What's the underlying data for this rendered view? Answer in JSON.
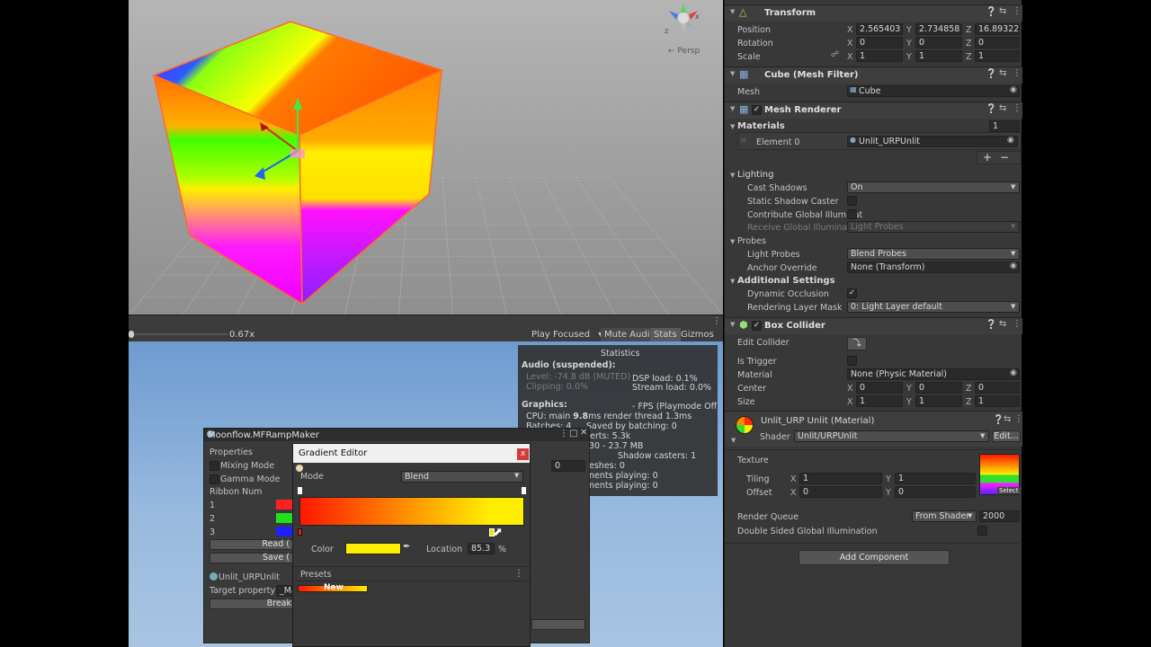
{
  "scene": {
    "persp_label": "Persp",
    "axis_z": "z",
    "axis_x": "x"
  },
  "game_toolbar": {
    "scale_value": "0.67x",
    "play_focused": "Play Focused",
    "mute_audio": "Mute Audio",
    "stats": "Stats",
    "gizmos": "Gizmos"
  },
  "stats": {
    "title": "Statistics",
    "audio_header": "Audio (suspended):",
    "level": "Level: -74.8 dB (MUTED)",
    "clipping": "Clipping: 0.0%",
    "dsp_load": "DSP load: 0.1%",
    "stream_load": "Stream load: 0.0%",
    "graphics_header": "Graphics:",
    "fps": "- FPS (Playmode Off",
    "cpu_prefix": "CPU: main ",
    "cpu_main": "9.8",
    "cpu_suffix": "ms  render thread 1.3ms",
    "batches": "Batches: 4",
    "saved_batching": "Saved by batching: 0",
    "verts": "erts: 5.3k",
    "memory": "30 - 23.7 MB",
    "shadow_casters": "Shadow casters: 1",
    "meshes": "eshes: 0",
    "animations_playing": "nents playing: 0",
    "animators_playing": "nents playing: 0"
  },
  "ramp_window": {
    "title": "Moonflow.MFRampMaker",
    "properties": "Properties",
    "mixing_mode": "Mixing Mode",
    "gamma_mode": "Gamma Mode",
    "ribbon_num": "Ribbon Num",
    "ribbon_value": "0",
    "rows": [
      {
        "label": "1",
        "color": "#ff2020"
      },
      {
        "label": "2",
        "color": "#20e020"
      },
      {
        "label": "3",
        "color": "#2020ff"
      }
    ],
    "read_button": "Read (",
    "save_button": "Save (",
    "material_name": "Unlit_URPUnlit",
    "target_property": "Target property",
    "target_value": "_Ma",
    "break_button": "Break"
  },
  "gradient_editor": {
    "title": "Gradient Editor",
    "close": "x",
    "mode_label": "Mode",
    "mode_value": "Blend",
    "color_label": "Color",
    "color_value": "#ffee00",
    "location_label": "Location",
    "location_value": "85.3",
    "location_unit": "%",
    "presets_label": "Presets",
    "preset_new": "New",
    "gradient_start": "#ff1800",
    "gradient_end": "#ffee00"
  },
  "inspector": {
    "transform": {
      "title": "Transform",
      "position_label": "Position",
      "rotation_label": "Rotation",
      "scale_label": "Scale",
      "position": {
        "x": "2.565403",
        "y": "2.734858",
        "z": "16.89322"
      },
      "rotation": {
        "x": "0",
        "y": "0",
        "z": "0"
      },
      "scale": {
        "x": "1",
        "y": "1",
        "z": "1"
      }
    },
    "mesh_filter": {
      "title": "Cube (Mesh Filter)",
      "mesh_label": "Mesh",
      "mesh_value": "Cube"
    },
    "mesh_renderer": {
      "title": "Mesh Renderer",
      "materials_label": "Materials",
      "materials_count": "1",
      "element0_label": "Element 0",
      "element0_value": "Unlit_URPUnlit",
      "lighting_label": "Lighting",
      "cast_shadows_label": "Cast Shadows",
      "cast_shadows_value": "On",
      "static_shadow_caster": "Static Shadow Caster",
      "contribute_gi": "Contribute Global Illuminat",
      "receive_gi": "Receive Global Illuminatio",
      "receive_gi_value": "Light Probes",
      "probes_label": "Probes",
      "light_probes_label": "Light Probes",
      "light_probes_value": "Blend Probes",
      "anchor_override_label": "Anchor Override",
      "anchor_override_value": "None (Transform)",
      "additional_settings": "Additional Settings",
      "dynamic_occlusion": "Dynamic Occlusion",
      "rendering_layer_mask": "Rendering Layer Mask",
      "rendering_layer_value": "0: Light Layer default"
    },
    "box_collider": {
      "title": "Box Collider",
      "edit_collider": "Edit Collider",
      "is_trigger": "Is Trigger",
      "material_label": "Material",
      "material_value": "None (Physic Material)",
      "center_label": "Center",
      "size_label": "Size",
      "center": {
        "x": "0",
        "y": "0",
        "z": "0"
      },
      "size": {
        "x": "1",
        "y": "1",
        "z": "1"
      }
    },
    "material": {
      "title": "Unlit_URP Unlit (Material)",
      "shader_label": "Shader",
      "shader_value": "Unlit/URPUnlit",
      "edit_button": "Edit...",
      "texture_label": "Texture",
      "tiling_label": "Tiling",
      "offset_label": "Offset",
      "tiling": {
        "x": "1",
        "y": "1"
      },
      "offset": {
        "x": "0",
        "y": "0"
      },
      "select_label": "Select",
      "render_queue_label": "Render Queue",
      "render_queue_mode": "From Shader",
      "render_queue_value": "2000",
      "double_sided_gi": "Double Sided Global Illumination"
    },
    "add_component": "Add Component",
    "axis": {
      "x": "X",
      "y": "Y",
      "z": "Z"
    }
  }
}
